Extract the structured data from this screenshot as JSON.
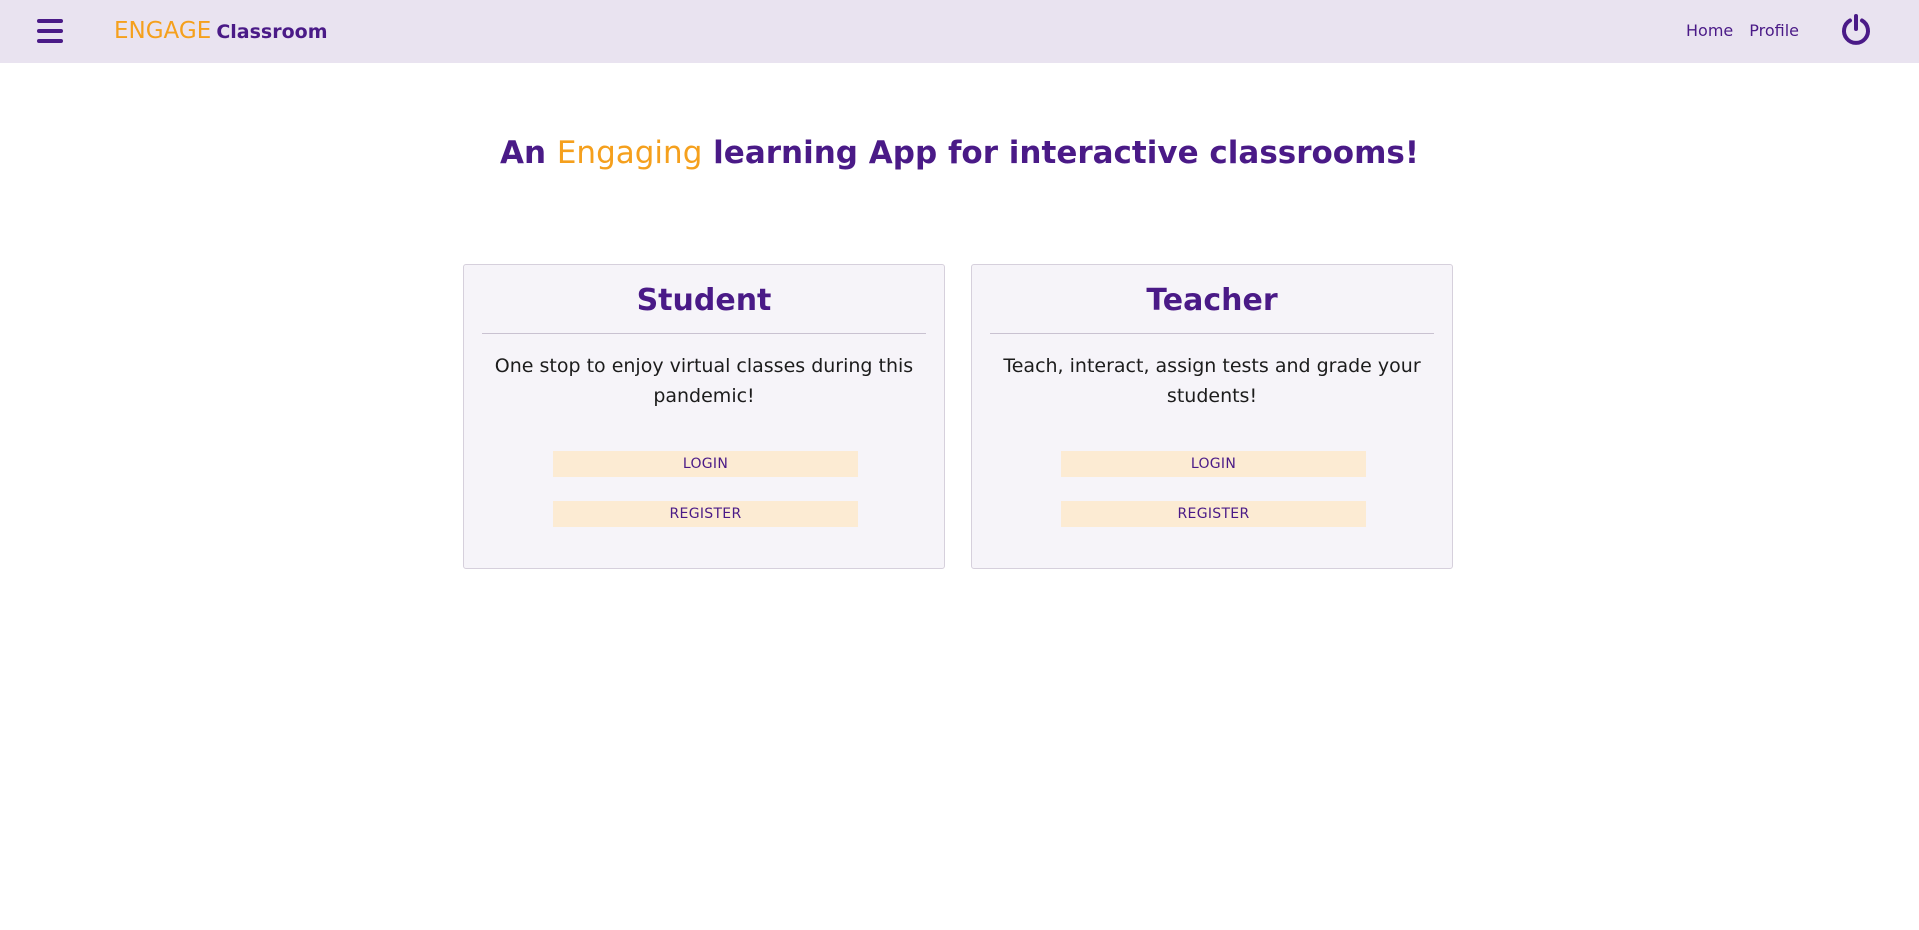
{
  "header": {
    "menu_icon": "hamburger-menu-icon",
    "brand_accent": "ENGAGE",
    "brand_rest": "Classroom",
    "nav": [
      {
        "label": "Home"
      },
      {
        "label": "Profile"
      }
    ],
    "power_icon": "power-icon"
  },
  "hero": {
    "before": "An",
    "highlight": "Engaging",
    "after": "learning App for interactive classrooms!"
  },
  "cards": [
    {
      "title": "Student",
      "description": "One stop to enjoy virtual classes during this pandemic!",
      "login_label": "LOGIN",
      "register_label": "REGISTER"
    },
    {
      "title": "Teacher",
      "description": "Teach, interact, assign tests and grade your students!",
      "login_label": "LOGIN",
      "register_label": "REGISTER"
    }
  ],
  "colors": {
    "primary": "#4a1a87",
    "accent": "#f5a01d",
    "topbar_bg": "#e9e3f0",
    "card_bg": "#f6f4f9",
    "button_bg": "#fcebd3"
  }
}
